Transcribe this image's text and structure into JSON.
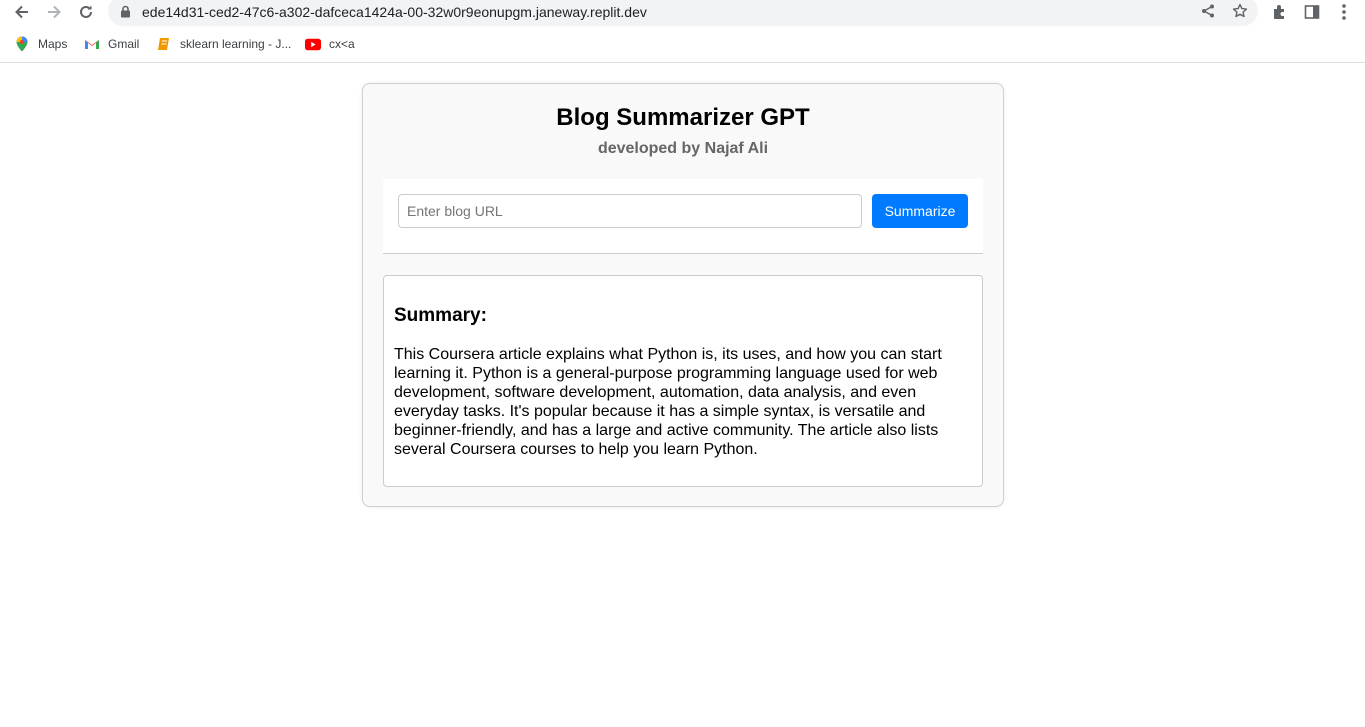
{
  "browser": {
    "url": "ede14d31-ced2-47c6-a302-dafceca1424a-00-32w0r9eonupgm.janeway.replit.dev",
    "bookmarks": [
      {
        "label": "Maps",
        "icon": "maps-icon"
      },
      {
        "label": "Gmail",
        "icon": "gmail-icon"
      },
      {
        "label": "sklearn learning - J...",
        "icon": "notebook-icon"
      },
      {
        "label": "cx<a",
        "icon": "youtube-icon"
      }
    ]
  },
  "app": {
    "title": "Blog Summarizer GPT",
    "subtitle": "developed by Najaf Ali",
    "input": {
      "placeholder": "Enter blog URL",
      "value": ""
    },
    "button_label": "Summarize",
    "summary_heading": "Summary:",
    "summary_text": "This Coursera article explains what Python is, its uses, and how you can start learning it. Python is a general-purpose programming language used for web development, software development, automation, data analysis, and even everyday tasks. It's popular because it has a simple syntax, is versatile and beginner-friendly, and has a large and active community. The article also lists several Coursera courses to help you learn Python."
  },
  "colors": {
    "accent": "#007bff",
    "card_bg": "#f9f9f9",
    "subtitle": "#666666"
  }
}
